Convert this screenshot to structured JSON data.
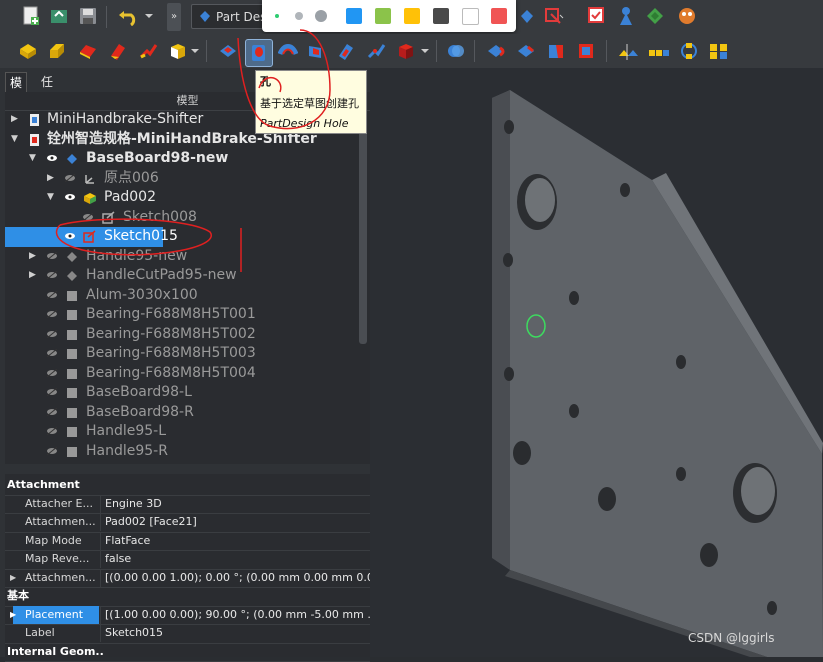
{
  "toolbar": {
    "workbench": "Part Des",
    "swatches": [
      "#2196f3",
      "#8bc34a",
      "#ffc107",
      "#4a4a4a",
      "#ffffff",
      "#f05454"
    ],
    "dots": [
      "#2ecc71",
      "#b0b5ba",
      "#9aa0a6"
    ]
  },
  "tooltip": {
    "title": "孔",
    "desc": "基于选定草图创建孔",
    "cmd": "PartDesign Hole"
  },
  "panel": {
    "tabs": [
      "模型",
      "任务"
    ],
    "tree_header": "模型"
  },
  "tree": [
    {
      "label": "MiniHandbrake-Shifter"
    },
    {
      "label": "铨州智造规格-MiniHandBrake-Shifter"
    },
    {
      "label": "BaseBoard98-new"
    },
    {
      "label": "原点006"
    },
    {
      "label": "Pad002"
    },
    {
      "label": "Sketch008"
    },
    {
      "label": "Sketch015"
    },
    {
      "label": "Handle95-new"
    },
    {
      "label": "HandleCutPad95-new"
    },
    {
      "label": "Alum-3030x100"
    },
    {
      "label": "Bearing-F688M8H5T001"
    },
    {
      "label": "Bearing-F688M8H5T002"
    },
    {
      "label": "Bearing-F688M8H5T003"
    },
    {
      "label": "Bearing-F688M8H5T004"
    },
    {
      "label": "BaseBoard98-L"
    },
    {
      "label": "BaseBoard98-R"
    },
    {
      "label": "Handle95-L"
    },
    {
      "label": "Handle95-R"
    }
  ],
  "properties": [
    {
      "key": "Attachment",
      "value": ""
    },
    {
      "key": "Attacher E...",
      "value": "Engine 3D"
    },
    {
      "key": "Attachmen...",
      "value": "Pad002 [Face21]"
    },
    {
      "key": "Map Mode",
      "value": "FlatFace"
    },
    {
      "key": "Map Reve...",
      "value": "false"
    },
    {
      "key": "Attachmen...",
      "value": "[(0.00 0.00 1.00); 0.00 °; (0.00 mm  0.00 mm  0.0..."
    },
    {
      "key": "基本",
      "value": ""
    },
    {
      "key": "Placement",
      "value": "[(1.00 0.00 0.00); 90.00 °; (0.00 mm  -5.00 mm  ..."
    },
    {
      "key": "Label",
      "value": "Sketch015"
    },
    {
      "key": "Internal Geom..",
      "value": ""
    }
  ],
  "watermark": "CSDN @lggirls"
}
